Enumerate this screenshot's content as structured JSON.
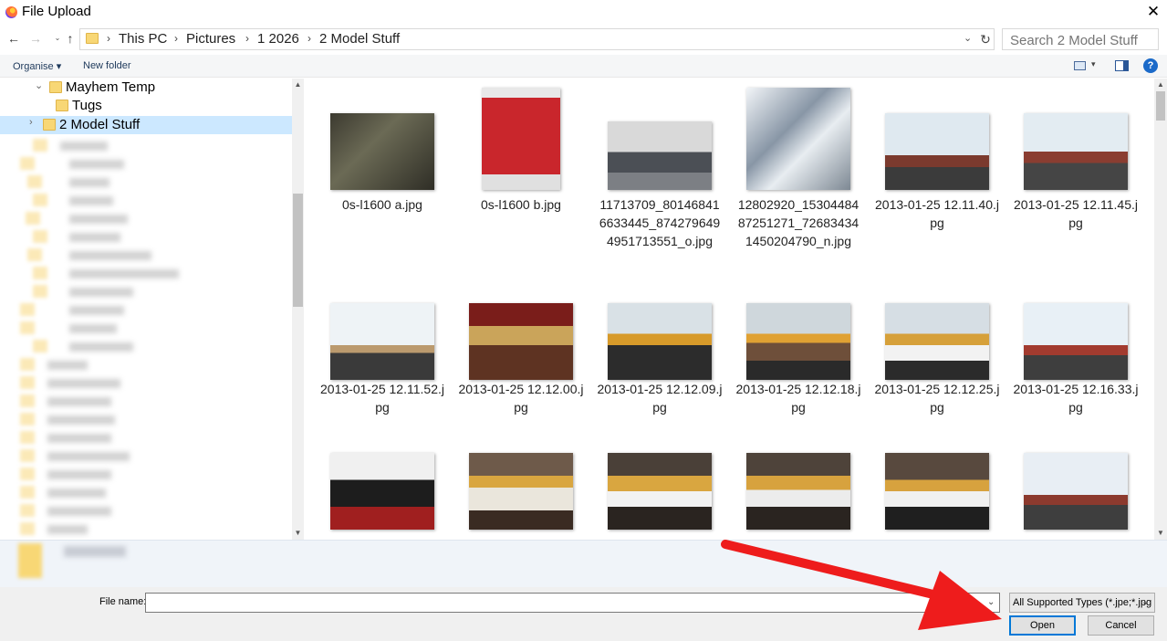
{
  "window": {
    "title": "File Upload",
    "close_symbol": "✕"
  },
  "nav": {
    "back": "←",
    "forward": "→",
    "recent": "⌄",
    "up": "↑",
    "refresh": "↻",
    "address_dropdown": "⌄"
  },
  "breadcrumb": [
    "This PC",
    "Pictures",
    "1 2026",
    "2 Model Stuff"
  ],
  "breadcrumb_sep": "›",
  "search": {
    "placeholder": "Search 2 Model Stuff"
  },
  "toolbar": {
    "organise": "Organise ▾",
    "new_folder": "New folder",
    "view_arrow": "▾",
    "help": "?"
  },
  "tree": [
    {
      "label": "Mayhem Temp",
      "chevron": "⌄"
    },
    {
      "label": "Tugs",
      "chevron": ""
    },
    {
      "label": "2 Model Stuff",
      "chevron": "›",
      "selected": true
    }
  ],
  "files": [
    {
      "name": "0s-l1600 a.jpg"
    },
    {
      "name": "0s-l1600 b.jpg"
    },
    {
      "name": "11713709_801468416633445_8742796494951713551_o.jpg"
    },
    {
      "name": "12802920_1530448487251271_726834341450204790_n.jpg"
    },
    {
      "name": "2013-01-25 12.11.40.jpg"
    },
    {
      "name": "2013-01-25 12.11.45.jpg"
    },
    {
      "name": "2013-01-25 12.11.52.jpg"
    },
    {
      "name": "2013-01-25 12.12.00.jpg"
    },
    {
      "name": "2013-01-25 12.12.09.jpg"
    },
    {
      "name": "2013-01-25 12.12.18.jpg"
    },
    {
      "name": "2013-01-25 12.12.25.jpg"
    },
    {
      "name": "2013-01-25 12.16.33.jpg"
    },
    {
      "name": ""
    },
    {
      "name": ""
    },
    {
      "name": ""
    },
    {
      "name": ""
    },
    {
      "name": ""
    },
    {
      "name": ""
    }
  ],
  "scroll": {
    "up": "▲",
    "down": "▼"
  },
  "bottom": {
    "filename_label": "File name:",
    "filename_value": "",
    "filename_dropdown": "⌄",
    "filetype": "All Supported Types (*.jpe;*.jpg",
    "filetype_arrow": "⌄",
    "open": "Open",
    "cancel": "Cancel"
  },
  "colors": {
    "accent": "#0078d7",
    "selected_bg": "#cce8ff",
    "annotation_arrow": "#ee1c1c"
  }
}
